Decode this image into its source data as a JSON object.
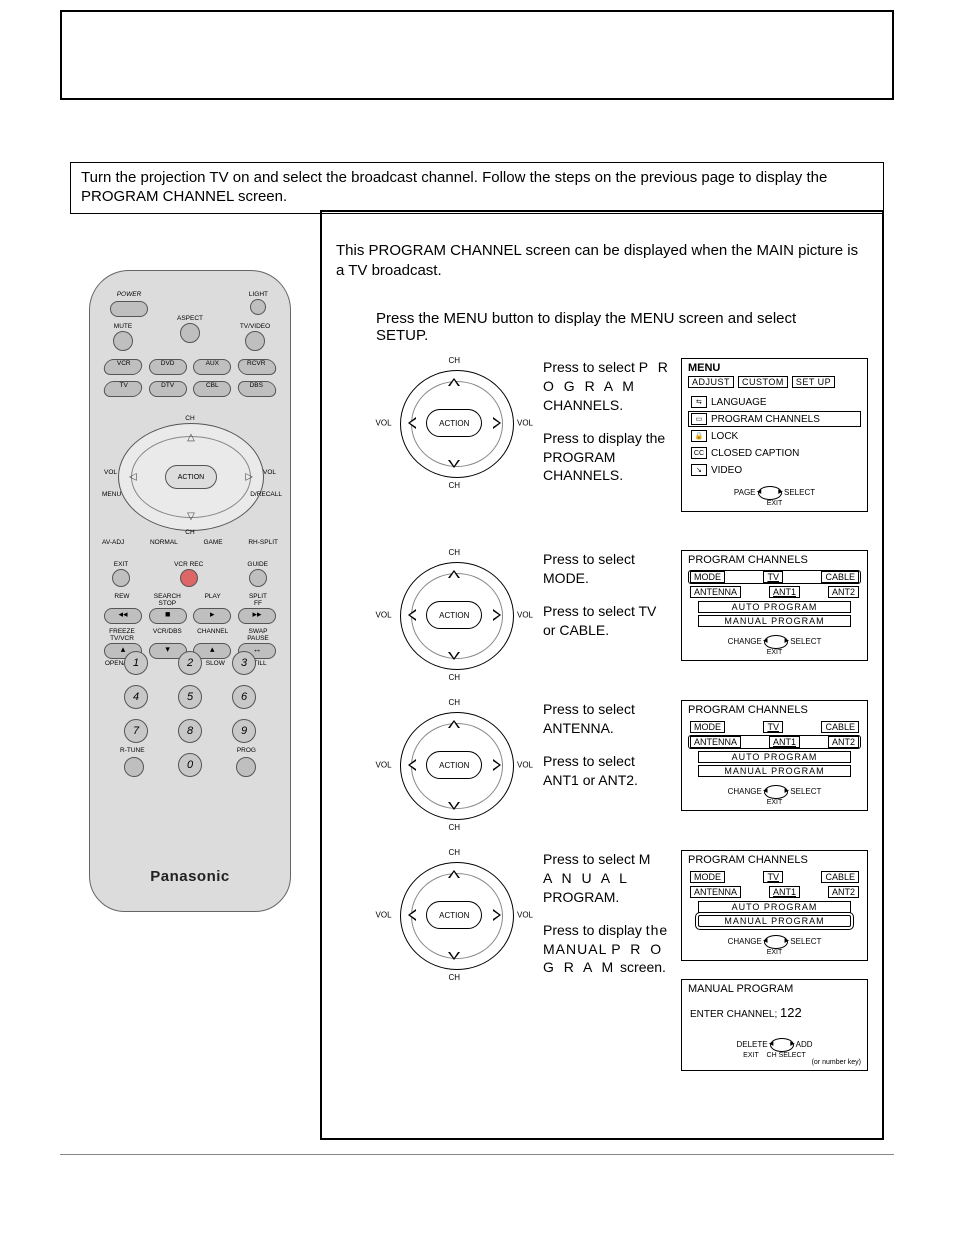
{
  "intro_text": "Turn the projection TV on and select the broadcast channel. Follow the steps on the previous page to display the PROGRAM CHANNEL screen.",
  "frame": {
    "para": "This PROGRAM CHANNEL screen can be displayed when the MAIN picture is a TV broadcast.",
    "setup_line": "Press the MENU button to display the MENU screen and select SETUP."
  },
  "dpad": {
    "ch": "CH",
    "vol": "VOL",
    "action": "ACTION"
  },
  "steps": {
    "s1a": "Press to select PROGRAM CHANNELS.",
    "s1a_styled": "P R O G R A M",
    "s1b": "Press to display the PROGRAM CHANNELS.",
    "s2a": "Press to select MODE.",
    "s2b": "Press to select TV or CABLE.",
    "s3a": "Press to select ANTENNA.",
    "s3b": "Press to select ANT1 or ANT2.",
    "s4a": "Press to select MANUAL PROGRAM.",
    "s4a_styled": "M A N U A L",
    "s4b": "Press to display the MANUAL PROGRAM screen.",
    "s4b_styled1": "the  MANUAL",
    "s4b_styled2": "P R O G R A M"
  },
  "osd": {
    "menu": {
      "title": "MENU",
      "tabs": [
        "ADJUST",
        "CUSTOM",
        "SET  UP"
      ],
      "items": [
        {
          "icon": "⇆",
          "label": "LANGUAGE"
        },
        {
          "icon": "▭",
          "label": "PROGRAM  CHANNELS",
          "sel": true
        },
        {
          "icon": "🔒",
          "label": "LOCK"
        },
        {
          "icon": "CC",
          "label": "CLOSED  CAPTION"
        },
        {
          "icon": "↘",
          "label": "VIDEO"
        }
      ],
      "nav_l": "PAGE",
      "nav_r": "SELECT",
      "nav_exit": "EXIT",
      "nav_center": "ACTION"
    },
    "pc": {
      "title": "PROGRAM  CHANNELS",
      "mode": "MODE",
      "tv": "TV",
      "cable": "CABLE",
      "antenna": "ANTENNA",
      "ant1": "ANT1",
      "ant2": "ANT2",
      "auto": "AUTO  PROGRAM",
      "manual": "MANUAL  PROGRAM",
      "nav_l": "CHANGE",
      "nav_r": "SELECT",
      "nav_exit": "EXIT"
    },
    "mp": {
      "title": "MANUAL  PROGRAM",
      "enter": "ENTER  CHANNEL;",
      "num": "122",
      "nav_l": "DELETE",
      "nav_r": "ADD",
      "nav_sub": "CH SELECT",
      "nav_sub2": "(or number key)",
      "nav_exit": "EXIT"
    }
  },
  "remote": {
    "power": "POWER",
    "light": "LIGHT",
    "aspect": "ASPECT",
    "mute": "MUTE",
    "tvvideo": "TV/VIDEO",
    "vcr": "VCR",
    "dvd": "DVD",
    "aux": "AUX",
    "rcvr": "RCVR",
    "tv": "TV",
    "dtv": "DTV",
    "cbl": "CBL",
    "dbs": "DBS",
    "ch": "CH",
    "vol": "VOL",
    "action": "ACTION",
    "menu": "MENU",
    "recall": "D/RECALL",
    "row_modes": [
      "AV-ADJ",
      "NORMAL",
      "GAME",
      "RH-SPLIT"
    ],
    "exit": "EXIT",
    "vcrrec": "VCR REC",
    "guide": "GUIDE",
    "rew": "REW",
    "search_stop": "SEARCH\nSTOP",
    "play": "PLAY",
    "split_ff": "SPLIT\nFF",
    "freeze": "FREEZE\nTV/VCR",
    "vcrdbs": "VCR/DBS",
    "channel": "CHANNEL",
    "swap": "SWAP\nPAUSE",
    "openclose": "OPEN/CLOSE",
    "slow": "SLOW",
    "still": "STILL",
    "nums": [
      "1",
      "2",
      "3",
      "4",
      "5",
      "6",
      "7",
      "8",
      "9",
      "0"
    ],
    "rtune": "R-TUNE",
    "prog": "PROG",
    "logo": "Panasonic"
  }
}
